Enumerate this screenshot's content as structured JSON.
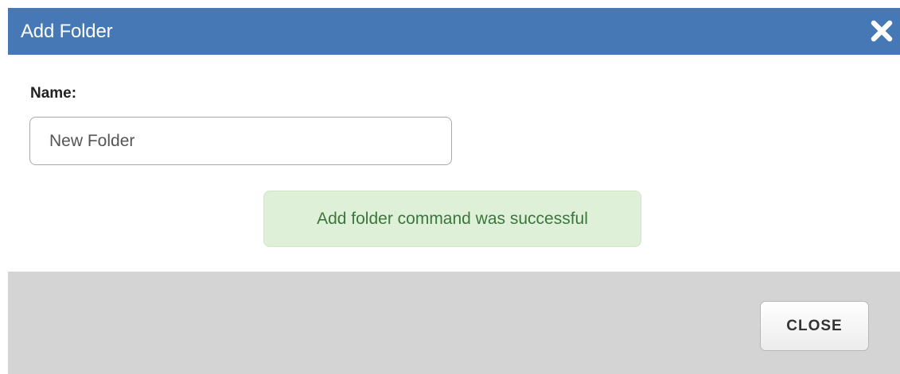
{
  "dialog": {
    "title": "Add Folder",
    "close_icon": "close-x-icon"
  },
  "form": {
    "name_label": "Name:",
    "name_value": "New Folder"
  },
  "alert": {
    "message": "Add folder command was successful",
    "status": "success",
    "color": "#3c763d"
  },
  "footer": {
    "close_label": "CLOSE"
  },
  "colors": {
    "titlebar": "#4578b4",
    "footer": "#d4d4d4",
    "alert_bg": "#dff0d8"
  }
}
